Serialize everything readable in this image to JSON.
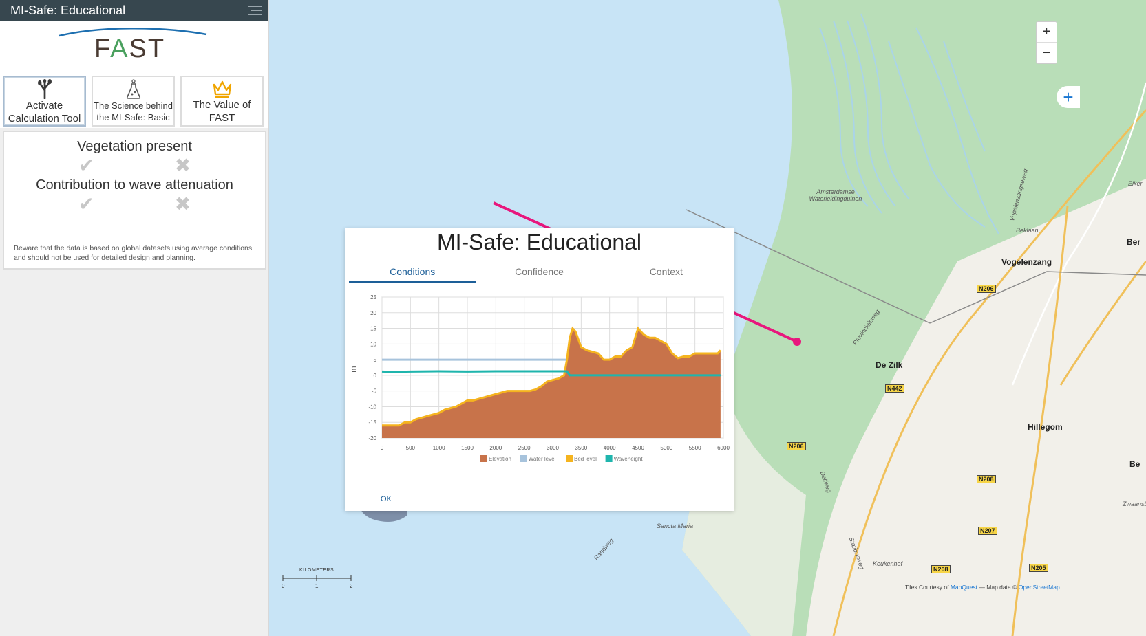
{
  "app": {
    "title": "MI-Safe: Educational"
  },
  "logo": {
    "text_pre": "F",
    "text_mid": "A",
    "text_post": "ST"
  },
  "sidebar": {
    "buttons": [
      {
        "label": "Activate Calculation Tool",
        "icon": "plant-icon"
      },
      {
        "label": "The Science behind the MI-Safe: Basic",
        "icon": "flask-icon"
      },
      {
        "label": "The Value of FAST",
        "icon": "crown-icon"
      }
    ],
    "info": {
      "vegetation_heading": "Vegetation present",
      "attenuation_heading": "Contribution to wave attenuation",
      "check_glyph": "✔",
      "cross_glyph": "✖",
      "disclaimer": "Beware that the data is based on global datasets using average conditions and should not be used for detailed design and planning."
    }
  },
  "map": {
    "zoom_in": "+",
    "zoom_out": "−",
    "expand": "+",
    "labels": {
      "amsterdamse": "Amsterdamse Waterleidingduinen",
      "vogelenzang": "Vogelenzang",
      "de_zilk": "De Zilk",
      "hillegom": "Hillegom",
      "sancta_maria": "Sancta Maria",
      "keukenhof": "Keukenhof",
      "beklaan": "Beklaan",
      "provincialeweg": "Provincialeweg",
      "delfweg": "Delfweg",
      "randweg": "Randweg",
      "stationsweg": "Stationsweg",
      "vogelenzangseweg": "Vogelenzangseweg",
      "zwaansb": "Zwaansb",
      "eiker": "Eiker",
      "ber": "Ber",
      "be": "Be"
    },
    "roads": [
      "N206",
      "N442",
      "N206",
      "N208",
      "N207",
      "N208",
      "N205"
    ],
    "scale": {
      "title": "KILOMETERS",
      "ticks": [
        "0",
        "1",
        "2"
      ]
    },
    "attribution_pre": "Tiles Courtesy of ",
    "attribution_link1": "MapQuest",
    "attribution_mid": " — Map data © ",
    "attribution_link2": "OpenStreetMap",
    "colors": {
      "water": "#c8e4f6",
      "dunes": "#b8dfb7",
      "land": "#f3f1ec",
      "transect": "#e8177d"
    }
  },
  "modal": {
    "title": "MI-Safe: Educational",
    "tabs": [
      "Conditions",
      "Confidence",
      "Context"
    ],
    "active_tab": "Conditions",
    "ok_label": "OK"
  },
  "chart_data": {
    "type": "area",
    "ylabel": "m",
    "xlim": [
      0,
      6000
    ],
    "ylim": [
      -20,
      25
    ],
    "x_ticks": [
      0,
      500,
      1000,
      1500,
      2000,
      2500,
      3000,
      3500,
      4000,
      4500,
      5000,
      5500,
      6000
    ],
    "y_ticks": [
      -20,
      -15,
      -10,
      -5,
      0,
      5,
      10,
      15,
      20,
      25
    ],
    "grid": true,
    "legend_position": "bottom",
    "series": [
      {
        "name": "Elevation",
        "color": "#c8734a",
        "x": [
          0,
          300,
          400,
          500,
          600,
          700,
          800,
          900,
          1000,
          1100,
          1200,
          1300,
          1400,
          1500,
          1600,
          1700,
          1800,
          1900,
          2000,
          2100,
          2200,
          2300,
          2400,
          2500,
          2600,
          2700,
          2800,
          2900,
          3000,
          3100,
          3200,
          3250,
          3300,
          3350,
          3400,
          3500,
          3600,
          3700,
          3800,
          3900,
          4000,
          4100,
          4200,
          4300,
          4400,
          4450,
          4500,
          4550,
          4600,
          4700,
          4800,
          4900,
          5000,
          5100,
          5200,
          5300,
          5400,
          5500,
          5600,
          5700,
          5800,
          5900,
          5950
        ],
        "values": [
          -16,
          -16,
          -15,
          -15,
          -14,
          -13.5,
          -13,
          -12.5,
          -12,
          -11,
          -10.5,
          -10,
          -9,
          -8,
          -8,
          -7.5,
          -7,
          -6.5,
          -6,
          -5.5,
          -5,
          -5,
          -5,
          -5,
          -5,
          -4.5,
          -3.5,
          -2,
          -1.5,
          -1,
          0,
          5,
          12,
          15,
          14,
          9,
          8,
          7.5,
          7,
          5,
          5,
          6,
          6,
          8,
          9,
          12,
          15,
          14,
          13,
          12,
          12,
          11,
          10,
          7,
          5.5,
          6,
          6,
          7,
          7,
          7,
          7,
          7,
          8
        ]
      },
      {
        "name": "Water level",
        "color": "#a7c3dc",
        "x": [
          0,
          3250
        ],
        "values": [
          5,
          5
        ]
      },
      {
        "name": "Bed level",
        "color": "#f5b41f",
        "x": [
          0,
          300,
          400,
          500,
          600,
          700,
          800,
          900,
          1000,
          1100,
          1200,
          1300,
          1400,
          1500,
          1600,
          1700,
          1800,
          1900,
          2000,
          2100,
          2200,
          2300,
          2400,
          2500,
          2600,
          2700,
          2800,
          2900,
          3000,
          3100,
          3200,
          3250,
          3300,
          3350,
          3400,
          3500,
          3600,
          3700,
          3800,
          3900,
          4000,
          4100,
          4200,
          4300,
          4400,
          4450,
          4500,
          4550,
          4600,
          4700,
          4800,
          4900,
          5000,
          5100,
          5200,
          5300,
          5400,
          5500,
          5600,
          5700,
          5800,
          5900,
          5950
        ],
        "values": [
          -16,
          -16,
          -15,
          -15,
          -14,
          -13.5,
          -13,
          -12.5,
          -12,
          -11,
          -10.5,
          -10,
          -9,
          -8,
          -8,
          -7.5,
          -7,
          -6.5,
          -6,
          -5.5,
          -5,
          -5,
          -5,
          -5,
          -5,
          -4.5,
          -3.5,
          -2,
          -1.5,
          -1,
          0,
          5,
          12,
          15,
          14,
          9,
          8,
          7.5,
          7,
          5,
          5,
          6,
          6,
          8,
          9,
          12,
          15,
          14,
          13,
          12,
          12,
          11,
          10,
          7,
          5.5,
          6,
          6,
          7,
          7,
          7,
          7,
          7,
          8
        ]
      },
      {
        "name": "Waveheight",
        "color": "#1fb5ad",
        "x": [
          0,
          200,
          500,
          1000,
          1500,
          2000,
          2500,
          3000,
          3200,
          3250,
          3300,
          4000,
          5000,
          5950
        ],
        "values": [
          1.2,
          1.1,
          1.2,
          1.3,
          1.2,
          1.3,
          1.3,
          1.3,
          1.3,
          1.3,
          0,
          0,
          0,
          0
        ]
      }
    ]
  }
}
